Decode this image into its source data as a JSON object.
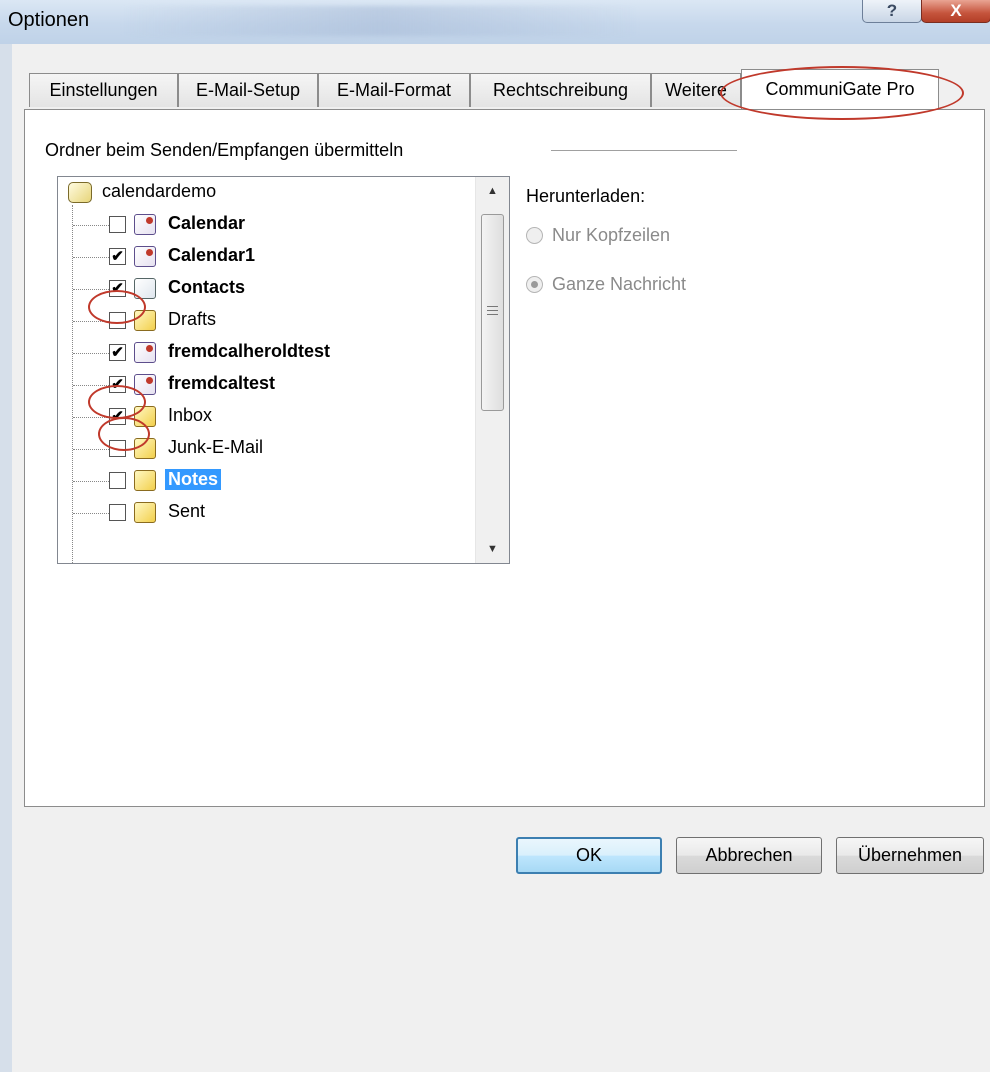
{
  "window": {
    "title": "Optionen",
    "help_label": "?",
    "close_label": "X"
  },
  "tabs": [
    {
      "label": "Einstellungen"
    },
    {
      "label": "E-Mail-Setup"
    },
    {
      "label": "E-Mail-Format"
    },
    {
      "label": "Rechtschreibung"
    },
    {
      "label": "Weitere"
    },
    {
      "label": "CommuniGate Pro",
      "active": true
    }
  ],
  "sync": {
    "group_label": "Ordner beim Senden/Empfangen übermitteln",
    "root": "calendardemo",
    "folders": [
      {
        "label": "Calendar",
        "checked": false,
        "bold": true,
        "icon": "calendar-icon"
      },
      {
        "label": "Calendar1",
        "checked": true,
        "bold": true,
        "icon": "calendar-icon"
      },
      {
        "label": "Contacts",
        "checked": true,
        "bold": true,
        "icon": "contacts-icon"
      },
      {
        "label": "Drafts",
        "checked": false,
        "bold": false,
        "icon": "folder-icon"
      },
      {
        "label": "fremdcalheroldtest",
        "checked": true,
        "bold": true,
        "icon": "calendar-icon"
      },
      {
        "label": "fremdcaltest",
        "checked": true,
        "bold": true,
        "icon": "calendar-icon"
      },
      {
        "label": "Inbox",
        "checked": true,
        "bold": false,
        "icon": "inbox-icon"
      },
      {
        "label": "Junk-E-Mail",
        "checked": false,
        "bold": false,
        "icon": "folder-icon"
      },
      {
        "label": "Notes",
        "checked": false,
        "bold": true,
        "selected": true,
        "icon": "notes-icon"
      },
      {
        "label": "Sent",
        "checked": false,
        "bold": false,
        "icon": "folder-icon"
      }
    ]
  },
  "download": {
    "label": "Herunterladen:",
    "options": [
      {
        "label": "Nur Kopfzeilen",
        "selected": false,
        "enabled": false
      },
      {
        "label": "Ganze Nachricht",
        "selected": true,
        "enabled": false
      }
    ]
  },
  "buttons": {
    "ok": "OK",
    "cancel": "Abbrechen",
    "apply": "Übernehmen"
  },
  "annotation_color": "#c0392b"
}
